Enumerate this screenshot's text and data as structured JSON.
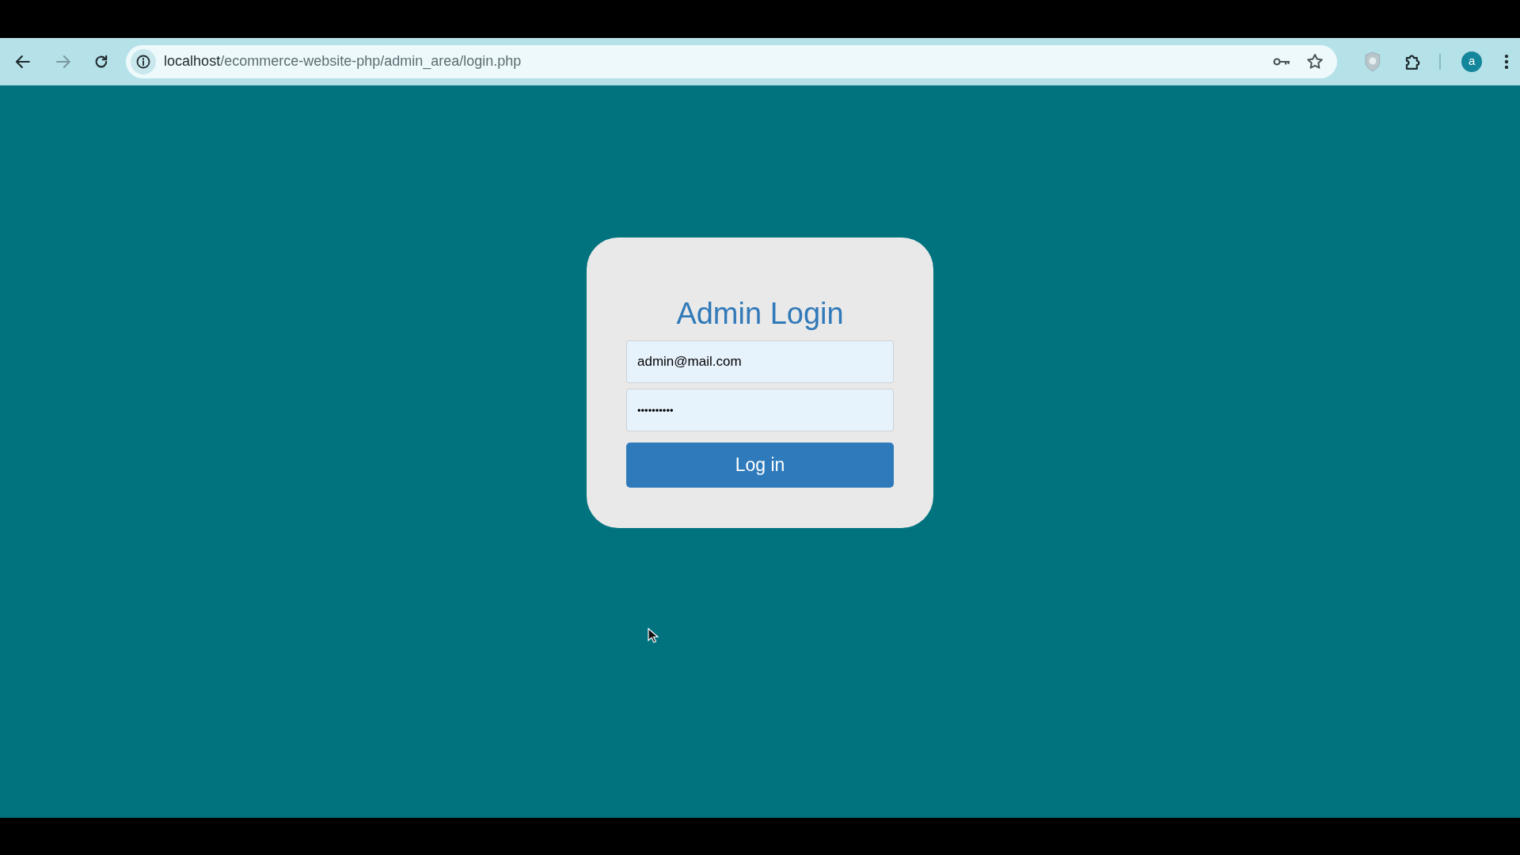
{
  "browser": {
    "url": "localhost/ecommerce-website-php/admin_area/login.php",
    "profile_initial": "a"
  },
  "login": {
    "title": "Admin Login",
    "email": {
      "value": "admin@mail.com"
    },
    "password": {
      "value": "••••••••••"
    },
    "button": "Log in"
  }
}
